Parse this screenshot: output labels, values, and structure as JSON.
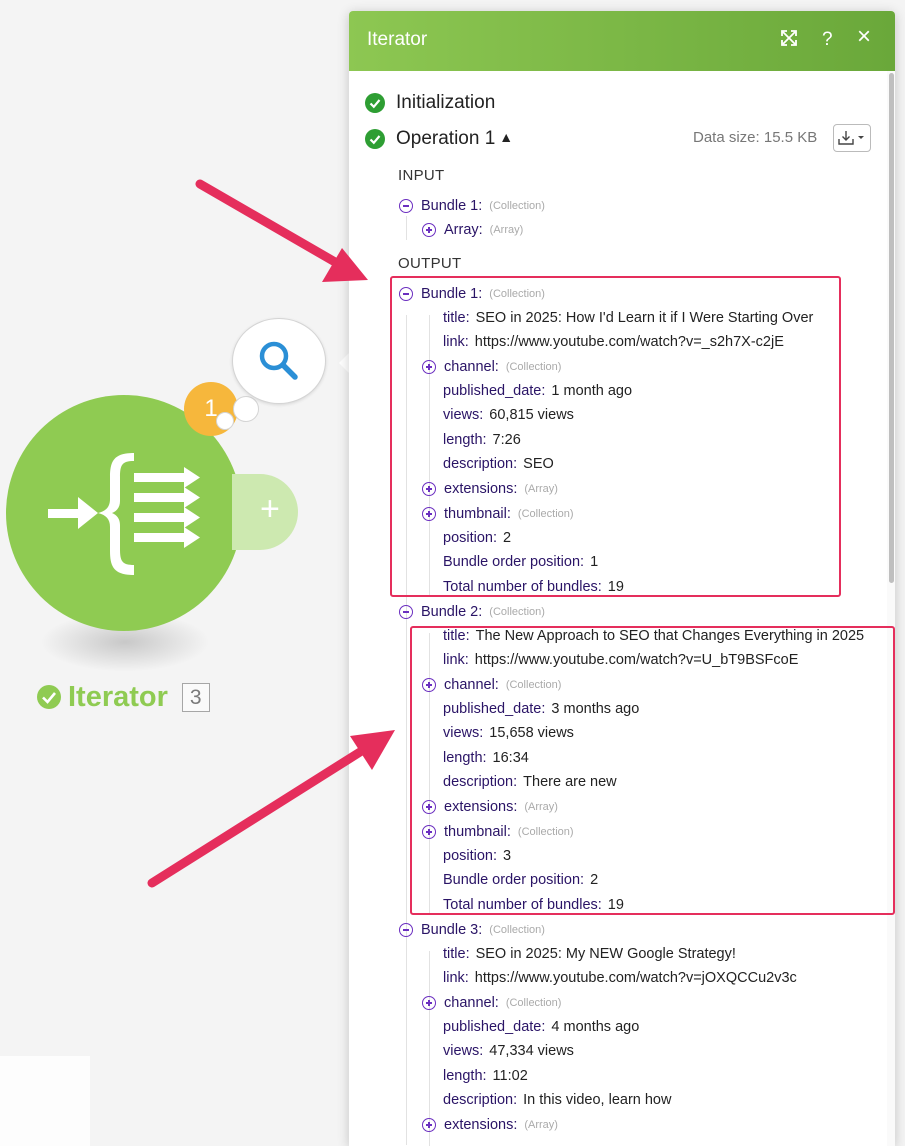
{
  "module": {
    "name": "Iterator",
    "id_badge": "3",
    "operations_count": "1",
    "color": "#8fcb52"
  },
  "panel": {
    "title": "Iterator",
    "header_icons": [
      "expand-icon",
      "help-icon",
      "close-icon"
    ],
    "help_label": "?",
    "close_label": "×",
    "initialization_label": "Initialization",
    "operation_label": "Operation 1",
    "data_size": "Data size: 15.5 KB",
    "input_label": "INPUT",
    "output_label": "OUTPUT"
  },
  "input": {
    "bundle_label": "Bundle 1:",
    "bundle_type": "(Collection)",
    "array_label": "Array:",
    "array_type": "(Array)"
  },
  "output": {
    "bundles": [
      {
        "label": "Bundle 1:",
        "type": "(Collection)",
        "title_key": "title:",
        "title": "SEO in 2025: How I'd Learn it if I Were Starting Over",
        "link_key": "link:",
        "link": "https://www.youtube.com/watch?v=_s2h7X-c2jE",
        "channel_key": "channel:",
        "channel_type": "(Collection)",
        "published_key": "published_date:",
        "published": "1 month ago",
        "views_key": "views:",
        "views": "60,815 views",
        "length_key": "length:",
        "length": "7:26",
        "description_key": "description:",
        "description": "SEO",
        "extensions_key": "extensions:",
        "extensions_type": "(Array)",
        "thumbnail_key": "thumbnail:",
        "thumbnail_type": "(Collection)",
        "position_key": "position:",
        "position": "2",
        "order_key": "Bundle order position:",
        "order": "1",
        "total_key": "Total number of bundles:",
        "total": "19"
      },
      {
        "label": "Bundle 2:",
        "type": "(Collection)",
        "title_key": "title:",
        "title": "The New Approach to SEO that Changes Everything in 2025",
        "link_key": "link:",
        "link": "https://www.youtube.com/watch?v=U_bT9BSFcoE",
        "channel_key": "channel:",
        "channel_type": "(Collection)",
        "published_key": "published_date:",
        "published": "3 months ago",
        "views_key": "views:",
        "views": "15,658 views",
        "length_key": "length:",
        "length": "16:34",
        "description_key": "description:",
        "description": "There are new",
        "extensions_key": "extensions:",
        "extensions_type": "(Array)",
        "thumbnail_key": "thumbnail:",
        "thumbnail_type": "(Collection)",
        "position_key": "position:",
        "position": "3",
        "order_key": "Bundle order position:",
        "order": "2",
        "total_key": "Total number of bundles:",
        "total": "19"
      },
      {
        "label": "Bundle 3:",
        "type": "(Collection)",
        "title_key": "title:",
        "title": "SEO in 2025: My NEW Google Strategy!",
        "link_key": "link:",
        "link": "https://www.youtube.com/watch?v=jOXQCCu2v3c",
        "channel_key": "channel:",
        "channel_type": "(Collection)",
        "published_key": "published_date:",
        "published": "4 months ago",
        "views_key": "views:",
        "views": "47,334 views",
        "length_key": "length:",
        "length": "11:02",
        "description_key": "description:",
        "description": "In this video, learn how",
        "extensions_key": "extensions:",
        "extensions_type": "(Array)"
      }
    ]
  },
  "colors": {
    "header_green": "#7ab845",
    "success_green": "#2e9e33",
    "key_purple": "#2a1466",
    "toggle_purple": "#6b2fc0",
    "annotation_red": "#e52e5c",
    "badge_orange": "#f6b73c"
  }
}
